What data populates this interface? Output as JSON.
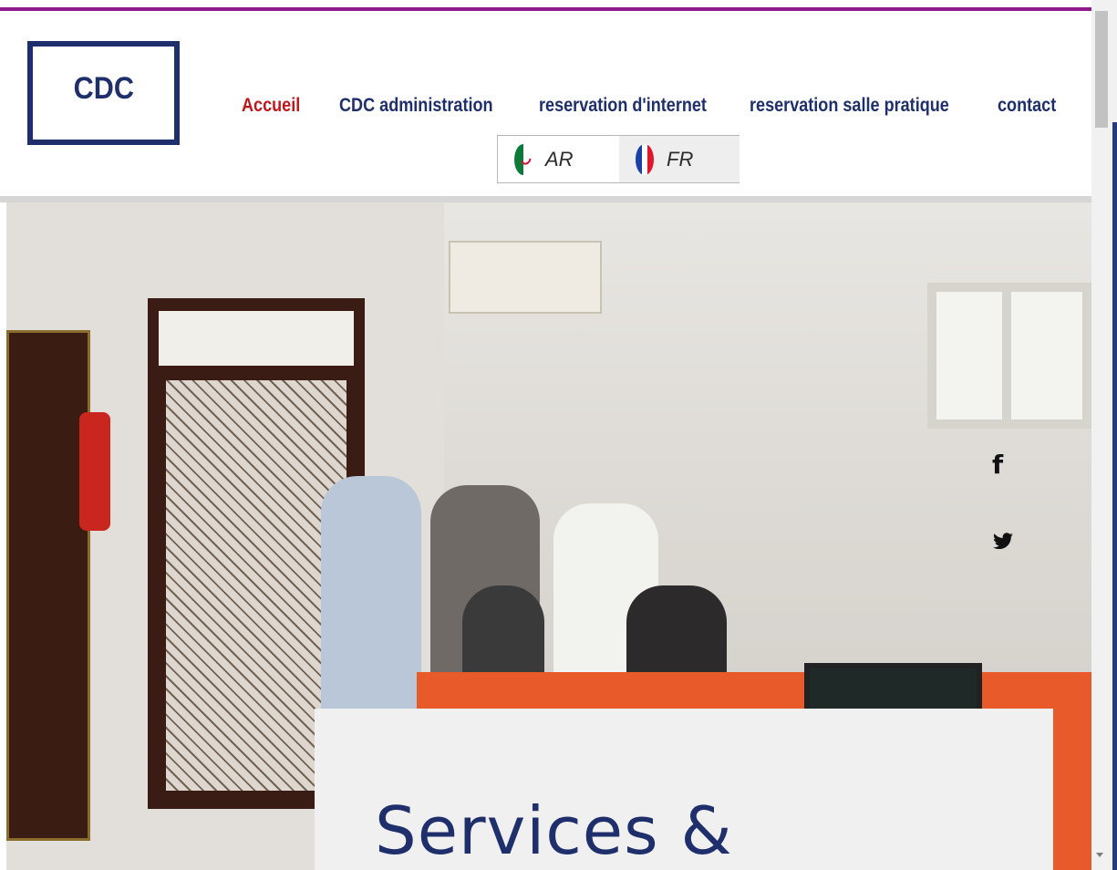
{
  "logo": {
    "text": "CDC"
  },
  "nav": {
    "items": [
      {
        "label": "Accueil",
        "active": true
      },
      {
        "label": "CDC administration",
        "active": false
      },
      {
        "label": "reservation d'internet",
        "active": false
      },
      {
        "label": "reservation salle pratique",
        "active": false
      },
      {
        "label": "contact",
        "active": false
      }
    ]
  },
  "languages": [
    {
      "code": "AR",
      "flag": "algeria-flag-icon"
    },
    {
      "code": "FR",
      "flag": "france-flag-icon",
      "selected": true
    }
  ],
  "social": {
    "facebook": "f",
    "twitter": "twitter-icon"
  },
  "hero": {
    "card_title": "Services &"
  },
  "colors": {
    "accent_top_line": "#8e1a8e",
    "brand_navy": "#1e2f6b",
    "active_nav": "#c0171d"
  }
}
